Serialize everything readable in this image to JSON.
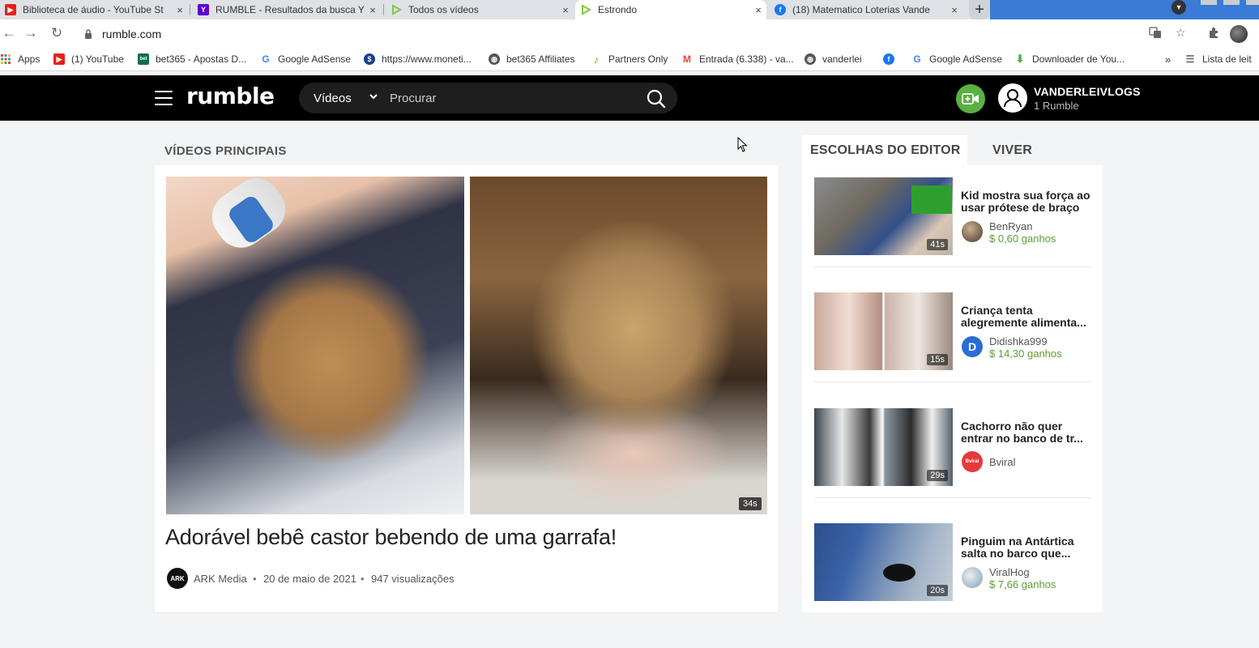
{
  "browser": {
    "tabs": [
      {
        "title": "Biblioteca de áudio - YouTube St",
        "icon": "youtube-icon",
        "color": "#e62117"
      },
      {
        "title": "RUMBLE - Resultados da busca Y",
        "icon": "yahoo-icon",
        "color": "#5f01d1"
      },
      {
        "title": "Todos os vídeos",
        "icon": "rumble-icon",
        "color": "#85c742"
      },
      {
        "title": "Estrondo",
        "icon": "rumble-icon",
        "color": "#85c742"
      },
      {
        "title": "(18) Matematico Loterias Vande",
        "icon": "facebook-icon",
        "color": "#1877f2"
      }
    ],
    "close_glyph": "×",
    "new_tab_glyph": "+",
    "url": "rumble.com",
    "bookmarks": [
      {
        "label": "Apps",
        "icon": "apps-grid-icon"
      },
      {
        "label": "(1) YouTube",
        "icon": "youtube-icon"
      },
      {
        "label": "bet365 - Apostas D...",
        "icon": "bet365-icon"
      },
      {
        "label": "Google AdSense",
        "icon": "google-icon"
      },
      {
        "label": "https://www.moneti...",
        "icon": "monetization-icon"
      },
      {
        "label": "bet365 Affiliates",
        "icon": "globe-icon"
      },
      {
        "label": "Partners Only",
        "icon": "partners-icon"
      },
      {
        "label": "Entrada (6.338) - va...",
        "icon": "gmail-icon"
      },
      {
        "label": "vanderlei",
        "icon": "globe-icon"
      },
      {
        "label": "",
        "icon": "facebook-icon"
      },
      {
        "label": "Google AdSense",
        "icon": "google-icon"
      },
      {
        "label": "Downloader de You...",
        "icon": "downloader-icon"
      }
    ],
    "bookmarks_more": "»",
    "reading_list": "Lista de leit"
  },
  "header": {
    "logo": "rumble",
    "search_category": "Vídeos",
    "search_placeholder": "Procurar",
    "user_name": "VANDERLEIVLOGS",
    "user_sub": "1 Rumble",
    "accent": "#5ab040"
  },
  "main": {
    "section_title": "VÍDEOS PRINCIPAIS",
    "featured": {
      "title": "Adorável bebê castor bebendo de uma garrafa!",
      "duration": "34s",
      "channel_badge": "ARK",
      "channel": "ARK Media",
      "date": "20 de maio de 2021",
      "views": "947 visualizações",
      "separator": "•"
    }
  },
  "sidebar": {
    "tab_active": "ESCOLHAS DO EDITOR",
    "tab_other": "VIVER",
    "items": [
      {
        "title": "Kid mostra sua força ao usar prótese de braço",
        "channel": "BenRyan",
        "earnings": "$ 0,60 ganhos",
        "duration": "41s"
      },
      {
        "title": "Criança tenta alegremente alimenta...",
        "channel": "Didishka999",
        "avatar_letter": "D",
        "earnings": "$ 14,30 ganhos",
        "duration": "15s"
      },
      {
        "title": "Cachorro não quer entrar no banco de tr...",
        "channel": "Bviral",
        "avatar_text": "Bviral",
        "earnings": "",
        "duration": "29s"
      },
      {
        "title": "Pinguim na Antártica salta no barco que...",
        "channel": "ViralHog",
        "earnings": "$ 7,66 ganhos",
        "duration": "20s"
      }
    ],
    "earn_color": "#5a9e2f"
  }
}
